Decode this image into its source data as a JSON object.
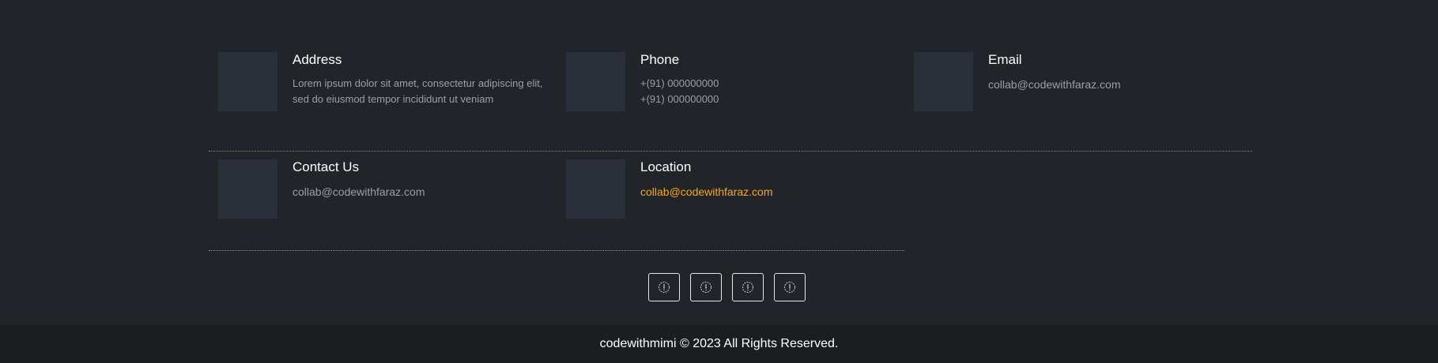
{
  "contact": {
    "address": {
      "title": "Address",
      "lines": [
        "Lorem ipsum dolor sit amet, consectetur adipiscing elit,",
        "sed do eiusmod tempor incididunt ut veniam"
      ]
    },
    "phone": {
      "title": "Phone",
      "numbers": [
        "+(91) 000000000",
        "+(91) 000000000"
      ]
    },
    "email": {
      "title": "Email",
      "value": "collab@codewithfaraz.com"
    },
    "contact_us": {
      "title": "Contact Us",
      "value": "collab@codewithfaraz.com"
    },
    "location": {
      "title": "Location",
      "value": "collab@codewithfaraz.com"
    }
  },
  "social": {
    "icons": [
      "social-icon",
      "social-icon",
      "social-icon",
      "social-icon"
    ]
  },
  "footer": {
    "copyright": "codewithmimi © 2023 All Rights Reserved."
  },
  "colors": {
    "background": "#212429",
    "copyright_background": "#1b1e21",
    "thumbnail": "#29303a",
    "accent": "#f5a623",
    "muted_text": "#9aa0a6"
  }
}
